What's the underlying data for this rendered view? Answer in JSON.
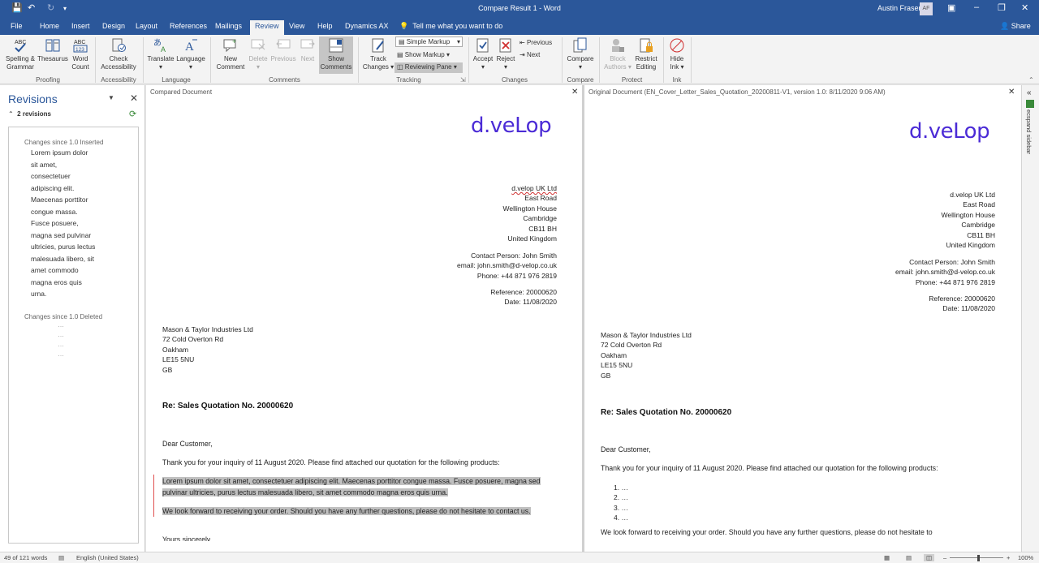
{
  "window": {
    "title": "Compare Result 1  -  Word",
    "user": "Austin Fraser",
    "avatar_initials": "AF",
    "share_label": "Share",
    "tell_me": "Tell me what you want to do"
  },
  "tabs": [
    "File",
    "Home",
    "Insert",
    "Design",
    "Layout",
    "References",
    "Mailings",
    "Review",
    "View",
    "Help",
    "Dynamics AX"
  ],
  "active_tab": "Review",
  "ribbon": {
    "spelling": "Spelling &",
    "spelling2": "Grammar",
    "thesaurus": "Thesaurus",
    "word_count": "Word",
    "word_count2": "Count",
    "check_access": "Check",
    "check_access2": "Accessibility",
    "translate": "Translate",
    "language": "Language",
    "new_comment": "New",
    "new_comment2": "Comment",
    "delete": "Delete",
    "previous": "Previous",
    "next": "Next",
    "show_comments": "Show",
    "show_comments2": "Comments",
    "track_changes": "Track",
    "track_changes2": "Changes",
    "simple_markup": "Simple Markup",
    "show_markup": "Show Markup",
    "reviewing_pane": "Reviewing Pane",
    "accept": "Accept",
    "reject": "Reject",
    "prev_change": "Previous",
    "next_change": "Next",
    "compare": "Compare",
    "block_authors": "Block",
    "block_authors2": "Authors",
    "restrict_editing": "Restrict",
    "restrict_editing2": "Editing",
    "hide_ink": "Hide",
    "hide_ink2": "Ink",
    "groups": {
      "proofing": "Proofing",
      "accessibility": "Accessibility",
      "language": "Language",
      "comments": "Comments",
      "tracking": "Tracking",
      "changes": "Changes",
      "compare": "Compare",
      "protect": "Protect",
      "ink": "Ink"
    }
  },
  "revisions": {
    "title": "Revisions",
    "count": "2 revisions",
    "inserted_header": "Changes since 1.0 Inserted",
    "inserted_text": "Lorem ipsum dolor sit amet, consectetuer adipiscing elit. Maecenas porttitor congue massa. Fusce posuere, magna sed pulvinar ultricies, purus lectus malesuada libero, sit amet commodo magna eros quis urna.",
    "deleted_header": "Changes since 1.0 Deleted",
    "deleted_dots": [
      "…",
      "…",
      "…",
      "…"
    ]
  },
  "compared": {
    "header": "Compared Document",
    "logo": "d.veLop",
    "sender": [
      "d.velop UK Ltd",
      "East Road",
      "Wellington House",
      "Cambridge",
      "CB11 BH",
      "United Kingdom"
    ],
    "contact": [
      "Contact Person: John Smith",
      "email: john.smith@d-velop.co.uk",
      "Phone: +44 871 976 2819"
    ],
    "reference": [
      "Reference: 20000620",
      "Date:  11/08/2020"
    ],
    "recipient": [
      "Mason & Taylor Industries Ltd",
      "72 Cold Overton Rd",
      "Oakham",
      "LE15 5NU",
      "GB"
    ],
    "subject": "Re: Sales Quotation No. 20000620",
    "greeting": "Dear Customer,",
    "intro": "Thank you for your inquiry of 11 August 2020. Please find attached our quotation for the following products:",
    "inserted_para": "Lorem ipsum dolor sit amet, consectetuer adipiscing elit. Maecenas porttitor congue massa. Fusce posuere, magna sed pulvinar ultricies, purus lectus malesuada libero, sit amet commodo magna eros quis urna.",
    "closing_para": "We look forward to receiving your order. Should you have any further questions, please do not hesitate to contact us.",
    "sign": "Yours sincerely"
  },
  "original": {
    "header": "Original Document (EN_Cover_Letter_Sales_Quotation_20200811-V1, version 1.0: 8/11/2020 9:06 AM)",
    "logo": "d.veLop",
    "sender": [
      "d.velop UK Ltd",
      "East Road",
      "Wellington House",
      "Cambridge",
      "CB11 BH",
      "United Kingdom"
    ],
    "contact": [
      "Contact Person: John Smith",
      "email: john.smith@d-velop.co.uk",
      "Phone: +44 871 976 2819"
    ],
    "reference": [
      "Reference: 20000620",
      "Date:  11/08/2020"
    ],
    "recipient": [
      "Mason & Taylor Industries Ltd",
      "72 Cold Overton Rd",
      "Oakham",
      "LE15 5NU",
      "GB"
    ],
    "subject": "Re: Sales Quotation No. 20000620",
    "greeting": "Dear Customer,",
    "intro": "Thank you for your inquiry of 11 August 2020. Please find attached our quotation for the following products:",
    "list": [
      "1.   …",
      "2.   …",
      "3.   …",
      "4.   …"
    ],
    "closing_para": "We look forward to receiving your order. Should you have any further questions, please do not hesitate to"
  },
  "sidebar_right": "ecspand sidebar",
  "status": {
    "words": "49 of 121 words",
    "language": "English (United States)",
    "zoom": "100%"
  },
  "colors": {
    "accent": "#2b579a",
    "logo": "#4b2bd6",
    "change_bar": "#e05050"
  }
}
